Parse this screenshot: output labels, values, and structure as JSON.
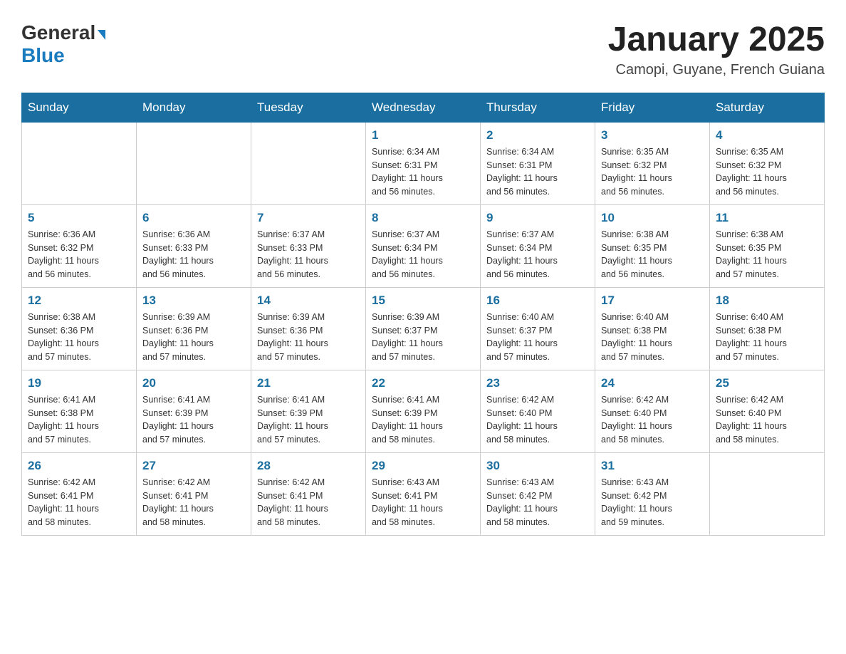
{
  "header": {
    "logo": {
      "general": "General",
      "blue": "Blue"
    },
    "title": "January 2025",
    "subtitle": "Camopi, Guyane, French Guiana"
  },
  "days_of_week": [
    "Sunday",
    "Monday",
    "Tuesday",
    "Wednesday",
    "Thursday",
    "Friday",
    "Saturday"
  ],
  "weeks": [
    [
      {
        "day": "",
        "info": ""
      },
      {
        "day": "",
        "info": ""
      },
      {
        "day": "",
        "info": ""
      },
      {
        "day": "1",
        "info": "Sunrise: 6:34 AM\nSunset: 6:31 PM\nDaylight: 11 hours\nand 56 minutes."
      },
      {
        "day": "2",
        "info": "Sunrise: 6:34 AM\nSunset: 6:31 PM\nDaylight: 11 hours\nand 56 minutes."
      },
      {
        "day": "3",
        "info": "Sunrise: 6:35 AM\nSunset: 6:32 PM\nDaylight: 11 hours\nand 56 minutes."
      },
      {
        "day": "4",
        "info": "Sunrise: 6:35 AM\nSunset: 6:32 PM\nDaylight: 11 hours\nand 56 minutes."
      }
    ],
    [
      {
        "day": "5",
        "info": "Sunrise: 6:36 AM\nSunset: 6:32 PM\nDaylight: 11 hours\nand 56 minutes."
      },
      {
        "day": "6",
        "info": "Sunrise: 6:36 AM\nSunset: 6:33 PM\nDaylight: 11 hours\nand 56 minutes."
      },
      {
        "day": "7",
        "info": "Sunrise: 6:37 AM\nSunset: 6:33 PM\nDaylight: 11 hours\nand 56 minutes."
      },
      {
        "day": "8",
        "info": "Sunrise: 6:37 AM\nSunset: 6:34 PM\nDaylight: 11 hours\nand 56 minutes."
      },
      {
        "day": "9",
        "info": "Sunrise: 6:37 AM\nSunset: 6:34 PM\nDaylight: 11 hours\nand 56 minutes."
      },
      {
        "day": "10",
        "info": "Sunrise: 6:38 AM\nSunset: 6:35 PM\nDaylight: 11 hours\nand 56 minutes."
      },
      {
        "day": "11",
        "info": "Sunrise: 6:38 AM\nSunset: 6:35 PM\nDaylight: 11 hours\nand 57 minutes."
      }
    ],
    [
      {
        "day": "12",
        "info": "Sunrise: 6:38 AM\nSunset: 6:36 PM\nDaylight: 11 hours\nand 57 minutes."
      },
      {
        "day": "13",
        "info": "Sunrise: 6:39 AM\nSunset: 6:36 PM\nDaylight: 11 hours\nand 57 minutes."
      },
      {
        "day": "14",
        "info": "Sunrise: 6:39 AM\nSunset: 6:36 PM\nDaylight: 11 hours\nand 57 minutes."
      },
      {
        "day": "15",
        "info": "Sunrise: 6:39 AM\nSunset: 6:37 PM\nDaylight: 11 hours\nand 57 minutes."
      },
      {
        "day": "16",
        "info": "Sunrise: 6:40 AM\nSunset: 6:37 PM\nDaylight: 11 hours\nand 57 minutes."
      },
      {
        "day": "17",
        "info": "Sunrise: 6:40 AM\nSunset: 6:38 PM\nDaylight: 11 hours\nand 57 minutes."
      },
      {
        "day": "18",
        "info": "Sunrise: 6:40 AM\nSunset: 6:38 PM\nDaylight: 11 hours\nand 57 minutes."
      }
    ],
    [
      {
        "day": "19",
        "info": "Sunrise: 6:41 AM\nSunset: 6:38 PM\nDaylight: 11 hours\nand 57 minutes."
      },
      {
        "day": "20",
        "info": "Sunrise: 6:41 AM\nSunset: 6:39 PM\nDaylight: 11 hours\nand 57 minutes."
      },
      {
        "day": "21",
        "info": "Sunrise: 6:41 AM\nSunset: 6:39 PM\nDaylight: 11 hours\nand 57 minutes."
      },
      {
        "day": "22",
        "info": "Sunrise: 6:41 AM\nSunset: 6:39 PM\nDaylight: 11 hours\nand 58 minutes."
      },
      {
        "day": "23",
        "info": "Sunrise: 6:42 AM\nSunset: 6:40 PM\nDaylight: 11 hours\nand 58 minutes."
      },
      {
        "day": "24",
        "info": "Sunrise: 6:42 AM\nSunset: 6:40 PM\nDaylight: 11 hours\nand 58 minutes."
      },
      {
        "day": "25",
        "info": "Sunrise: 6:42 AM\nSunset: 6:40 PM\nDaylight: 11 hours\nand 58 minutes."
      }
    ],
    [
      {
        "day": "26",
        "info": "Sunrise: 6:42 AM\nSunset: 6:41 PM\nDaylight: 11 hours\nand 58 minutes."
      },
      {
        "day": "27",
        "info": "Sunrise: 6:42 AM\nSunset: 6:41 PM\nDaylight: 11 hours\nand 58 minutes."
      },
      {
        "day": "28",
        "info": "Sunrise: 6:42 AM\nSunset: 6:41 PM\nDaylight: 11 hours\nand 58 minutes."
      },
      {
        "day": "29",
        "info": "Sunrise: 6:43 AM\nSunset: 6:41 PM\nDaylight: 11 hours\nand 58 minutes."
      },
      {
        "day": "30",
        "info": "Sunrise: 6:43 AM\nSunset: 6:42 PM\nDaylight: 11 hours\nand 58 minutes."
      },
      {
        "day": "31",
        "info": "Sunrise: 6:43 AM\nSunset: 6:42 PM\nDaylight: 11 hours\nand 59 minutes."
      },
      {
        "day": "",
        "info": ""
      }
    ]
  ]
}
